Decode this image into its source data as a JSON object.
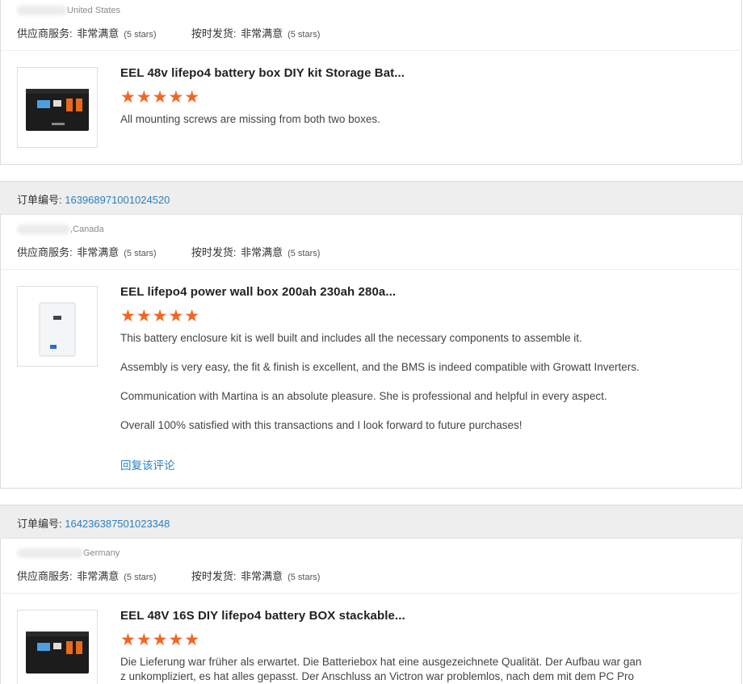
{
  "labels": {
    "order_no": "订单编号: ",
    "supplier_service": "供应商服务: ",
    "on_time_shipping": "按时发货: ",
    "very_satisfied": "非常满意",
    "stars_5": "(5 stars)"
  },
  "reviews": [
    {
      "country": "United States",
      "product_title": "EEL 48v lifepo4 battery box DIY kit Storage Bat...",
      "stars": "★★★★★",
      "rating": 5,
      "paragraphs": [
        "All mounting screws are missing from both two boxes."
      ]
    },
    {
      "order_number": "163968971001024520",
      "country": ",Canada",
      "product_title": "EEL lifepo4 power wall box 200ah 230ah 280a...",
      "stars": "★★★★★",
      "rating": 5,
      "paragraphs": [
        "This battery enclosure kit is well built and includes all the necessary components to assemble it.",
        "Assembly is very easy, the fit & finish is excellent, and the BMS is indeed compatible with Growatt Inverters.",
        "Communication with Martina is an absolute pleasure. She is professional and helpful in every aspect.",
        "Overall 100% satisfied with this transactions and I look forward to future purchases!"
      ],
      "reply_link": "回复该评论"
    },
    {
      "order_number": "164236387501023348",
      "country": "Germany",
      "product_title": "EEL 48V 16S DIY lifepo4 battery BOX stackable...",
      "stars": "★★★★★",
      "rating": 5,
      "paragraph_lines": [
        "Die Lieferung war früher als erwartet. Die Batteriebox hat eine ausgezeichnete Qualität. Der Aufbau war gan",
        "z unkompliziert, es hat alles gepasst. Der Anschluss an Victron war problemlos, nach dem mit dem PC Pro"
      ]
    }
  ],
  "colors": {
    "link": "#2a7fc1",
    "star": "#f26522",
    "order_bar": "#eeeeee"
  }
}
